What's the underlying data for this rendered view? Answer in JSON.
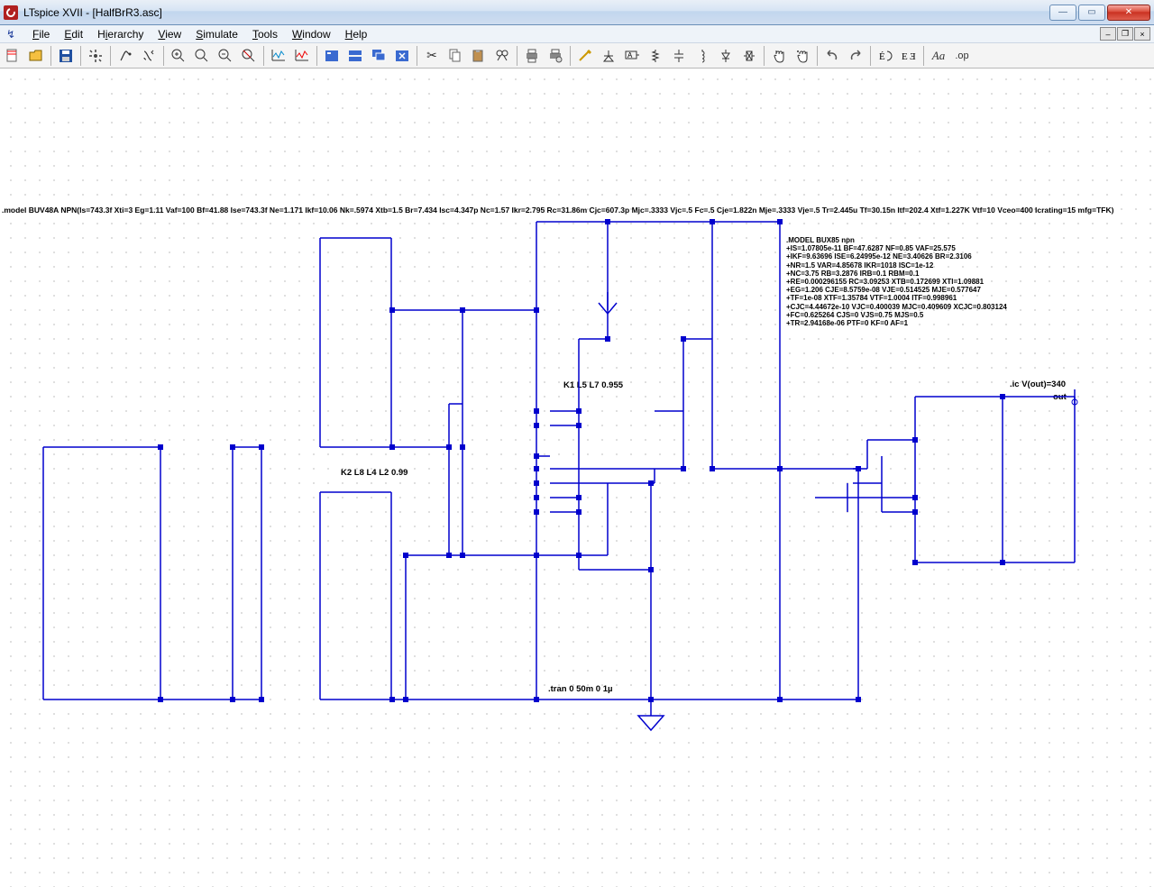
{
  "title": "LTspice XVII - [HalfBrR3.asc]",
  "menus": {
    "file": "File",
    "edit": "Edit",
    "hierarchy": "Hierarchy",
    "view": "View",
    "simulate": "Simulate",
    "tools": "Tools",
    "window": "Window",
    "help": "Help"
  },
  "directive_model_line": ".model BUV48A NPN(Is=743.3f Xti=3 Eg=1.11 Vaf=100 Bf=41.88 Ise=743.3f Ne=1.171 Ikf=10.06 Nk=.5974 Xtb=1.5 Br=7.434 Isc=4.347p Nc=1.57 Ikr=2.795 Rc=31.86m Cjc=607.3p Mjc=.3333 Vjc=.5 Fc=.5 Cje=1.822n Mje=.3333 Vje=.5 Tr=2.445u Tf=30.15n Itf=202.4 Xtf=1.227K Vtf=10 Vceo=400 Icrating=15 mfg=TFK)",
  "k1": "K1 L5 L7 0.955",
  "k2": "K2 L8 L4 L2 0.99",
  "tran": ".tran 0 50m 0 1µ",
  "ic": ".ic V(out)=340",
  "net_out": "out",
  "model_block": [
    ".MODEL BUX85 npn",
    "+IS=1.07805e-11 BF=47.6287 NF=0.85 VAF=25.575",
    "+IKF=9.63696 ISE=6.24995e-12 NE=3.40626 BR=2.3106",
    "+NR=1.5 VAR=4.85678 IKR=1018 ISC=1e-12",
    "+NC=3.75 RB=3.2876 IRB=0.1 RBM=0.1",
    "+RE=0.000296155 RC=3.09253 XTB=0.172699 XTI=1.09881",
    "+EG=1.206 CJE=8.5759e-08 VJE=0.514525 MJE=0.577647",
    "+TF=1e-08 XTF=1.35784 VTF=1.0004 ITF=0.998961",
    "+CJC=4.44672e-10 VJC=0.400039 MJC=0.409609 XCJC=0.803124",
    "+FC=0.625264 CJS=0 VJS=0.75 MJS=0.5",
    "+TR=2.94168e-06 PTF=0 KF=0 AF=1"
  ]
}
